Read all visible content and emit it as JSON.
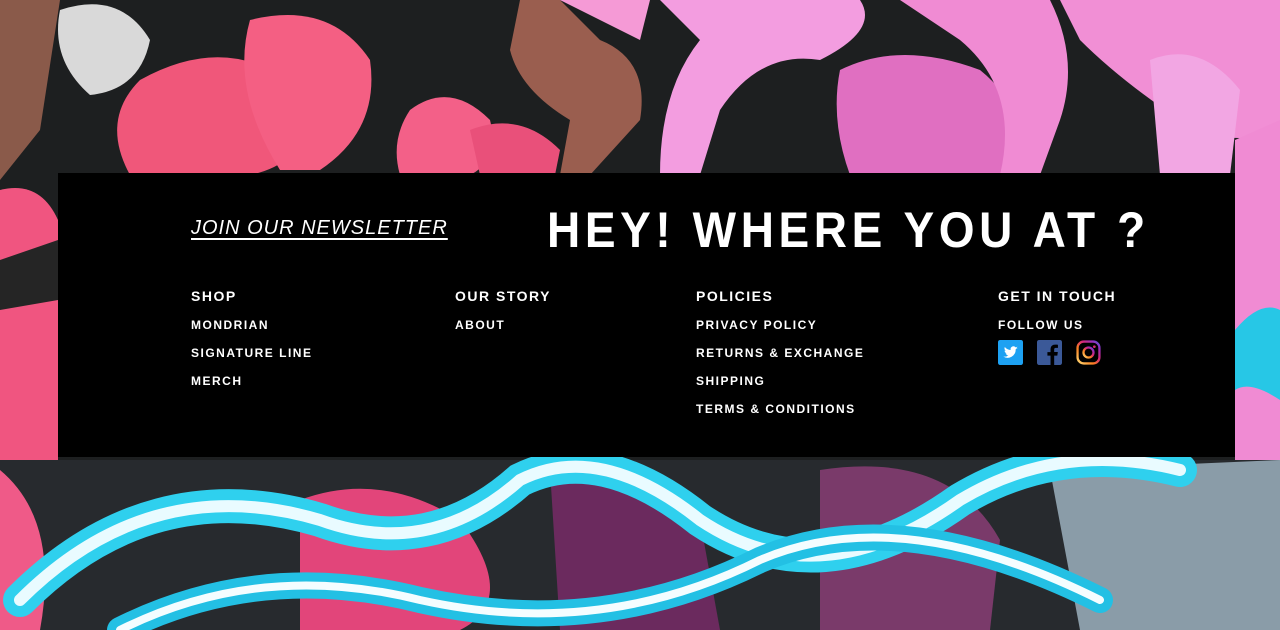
{
  "footer": {
    "newsletter": "JOIN OUR NEWSLETTER",
    "headline": "HEY! WHERE YOU AT ?",
    "columns": {
      "shop": {
        "title": "SHOP",
        "links": [
          "MONDRIAN",
          "SIGNATURE LINE",
          "MERCH"
        ]
      },
      "story": {
        "title": "OUR STORY",
        "links": [
          "ABOUT"
        ]
      },
      "policies": {
        "title": "POLICIES",
        "links": [
          "PRIVACY POLICY",
          "RETURNS & EXCHANGE",
          "SHIPPING",
          "TERMS & CONDITIONS"
        ]
      },
      "contact": {
        "title": "GET IN TOUCH",
        "follow": "FOLLOW US"
      }
    },
    "socials": [
      "twitter-icon",
      "facebook-icon",
      "instagram-icon"
    ]
  },
  "colors": {
    "panel": "#000000",
    "twitter": "#1da1f2",
    "facebook": "#3b5998"
  }
}
